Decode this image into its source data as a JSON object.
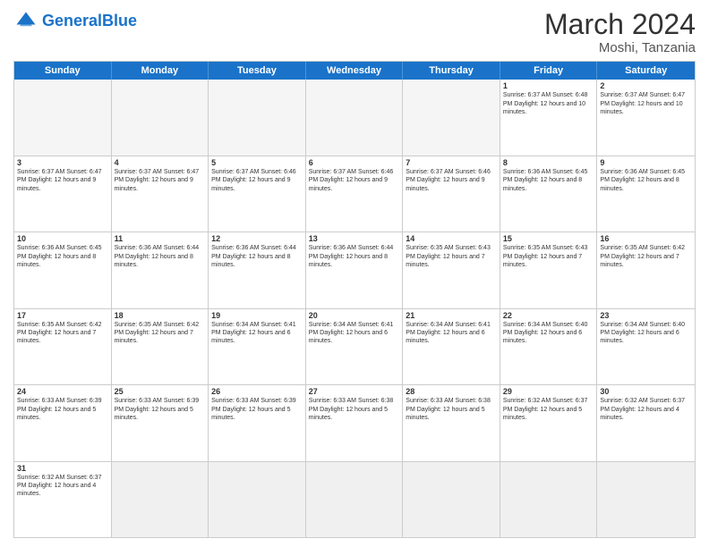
{
  "header": {
    "logo_general": "General",
    "logo_blue": "Blue",
    "month_title": "March 2024",
    "location": "Moshi, Tanzania"
  },
  "days_of_week": [
    "Sunday",
    "Monday",
    "Tuesday",
    "Wednesday",
    "Thursday",
    "Friday",
    "Saturday"
  ],
  "weeks": [
    [
      {
        "day": "",
        "info": "",
        "empty": true
      },
      {
        "day": "",
        "info": "",
        "empty": true
      },
      {
        "day": "",
        "info": "",
        "empty": true
      },
      {
        "day": "",
        "info": "",
        "empty": true
      },
      {
        "day": "",
        "info": "",
        "empty": true
      },
      {
        "day": "1",
        "info": "Sunrise: 6:37 AM\nSunset: 6:48 PM\nDaylight: 12 hours\nand 10 minutes."
      },
      {
        "day": "2",
        "info": "Sunrise: 6:37 AM\nSunset: 6:47 PM\nDaylight: 12 hours\nand 10 minutes."
      }
    ],
    [
      {
        "day": "3",
        "info": "Sunrise: 6:37 AM\nSunset: 6:47 PM\nDaylight: 12 hours\nand 9 minutes."
      },
      {
        "day": "4",
        "info": "Sunrise: 6:37 AM\nSunset: 6:47 PM\nDaylight: 12 hours\nand 9 minutes."
      },
      {
        "day": "5",
        "info": "Sunrise: 6:37 AM\nSunset: 6:46 PM\nDaylight: 12 hours\nand 9 minutes."
      },
      {
        "day": "6",
        "info": "Sunrise: 6:37 AM\nSunset: 6:46 PM\nDaylight: 12 hours\nand 9 minutes."
      },
      {
        "day": "7",
        "info": "Sunrise: 6:37 AM\nSunset: 6:46 PM\nDaylight: 12 hours\nand 9 minutes."
      },
      {
        "day": "8",
        "info": "Sunrise: 6:36 AM\nSunset: 6:45 PM\nDaylight: 12 hours\nand 8 minutes."
      },
      {
        "day": "9",
        "info": "Sunrise: 6:36 AM\nSunset: 6:45 PM\nDaylight: 12 hours\nand 8 minutes."
      }
    ],
    [
      {
        "day": "10",
        "info": "Sunrise: 6:36 AM\nSunset: 6:45 PM\nDaylight: 12 hours\nand 8 minutes."
      },
      {
        "day": "11",
        "info": "Sunrise: 6:36 AM\nSunset: 6:44 PM\nDaylight: 12 hours\nand 8 minutes."
      },
      {
        "day": "12",
        "info": "Sunrise: 6:36 AM\nSunset: 6:44 PM\nDaylight: 12 hours\nand 8 minutes."
      },
      {
        "day": "13",
        "info": "Sunrise: 6:36 AM\nSunset: 6:44 PM\nDaylight: 12 hours\nand 8 minutes."
      },
      {
        "day": "14",
        "info": "Sunrise: 6:35 AM\nSunset: 6:43 PM\nDaylight: 12 hours\nand 7 minutes."
      },
      {
        "day": "15",
        "info": "Sunrise: 6:35 AM\nSunset: 6:43 PM\nDaylight: 12 hours\nand 7 minutes."
      },
      {
        "day": "16",
        "info": "Sunrise: 6:35 AM\nSunset: 6:42 PM\nDaylight: 12 hours\nand 7 minutes."
      }
    ],
    [
      {
        "day": "17",
        "info": "Sunrise: 6:35 AM\nSunset: 6:42 PM\nDaylight: 12 hours\nand 7 minutes."
      },
      {
        "day": "18",
        "info": "Sunrise: 6:35 AM\nSunset: 6:42 PM\nDaylight: 12 hours\nand 7 minutes."
      },
      {
        "day": "19",
        "info": "Sunrise: 6:34 AM\nSunset: 6:41 PM\nDaylight: 12 hours\nand 6 minutes."
      },
      {
        "day": "20",
        "info": "Sunrise: 6:34 AM\nSunset: 6:41 PM\nDaylight: 12 hours\nand 6 minutes."
      },
      {
        "day": "21",
        "info": "Sunrise: 6:34 AM\nSunset: 6:41 PM\nDaylight: 12 hours\nand 6 minutes."
      },
      {
        "day": "22",
        "info": "Sunrise: 6:34 AM\nSunset: 6:40 PM\nDaylight: 12 hours\nand 6 minutes."
      },
      {
        "day": "23",
        "info": "Sunrise: 6:34 AM\nSunset: 6:40 PM\nDaylight: 12 hours\nand 6 minutes."
      }
    ],
    [
      {
        "day": "24",
        "info": "Sunrise: 6:33 AM\nSunset: 6:39 PM\nDaylight: 12 hours\nand 5 minutes."
      },
      {
        "day": "25",
        "info": "Sunrise: 6:33 AM\nSunset: 6:39 PM\nDaylight: 12 hours\nand 5 minutes."
      },
      {
        "day": "26",
        "info": "Sunrise: 6:33 AM\nSunset: 6:39 PM\nDaylight: 12 hours\nand 5 minutes."
      },
      {
        "day": "27",
        "info": "Sunrise: 6:33 AM\nSunset: 6:38 PM\nDaylight: 12 hours\nand 5 minutes."
      },
      {
        "day": "28",
        "info": "Sunrise: 6:33 AM\nSunset: 6:38 PM\nDaylight: 12 hours\nand 5 minutes."
      },
      {
        "day": "29",
        "info": "Sunrise: 6:32 AM\nSunset: 6:37 PM\nDaylight: 12 hours\nand 5 minutes."
      },
      {
        "day": "30",
        "info": "Sunrise: 6:32 AM\nSunset: 6:37 PM\nDaylight: 12 hours\nand 4 minutes."
      }
    ],
    [
      {
        "day": "31",
        "info": "Sunrise: 6:32 AM\nSunset: 6:37 PM\nDaylight: 12 hours\nand 4 minutes."
      },
      {
        "day": "",
        "info": "",
        "empty": true
      },
      {
        "day": "",
        "info": "",
        "empty": true
      },
      {
        "day": "",
        "info": "",
        "empty": true
      },
      {
        "day": "",
        "info": "",
        "empty": true
      },
      {
        "day": "",
        "info": "",
        "empty": true
      },
      {
        "day": "",
        "info": "",
        "empty": true
      }
    ]
  ]
}
